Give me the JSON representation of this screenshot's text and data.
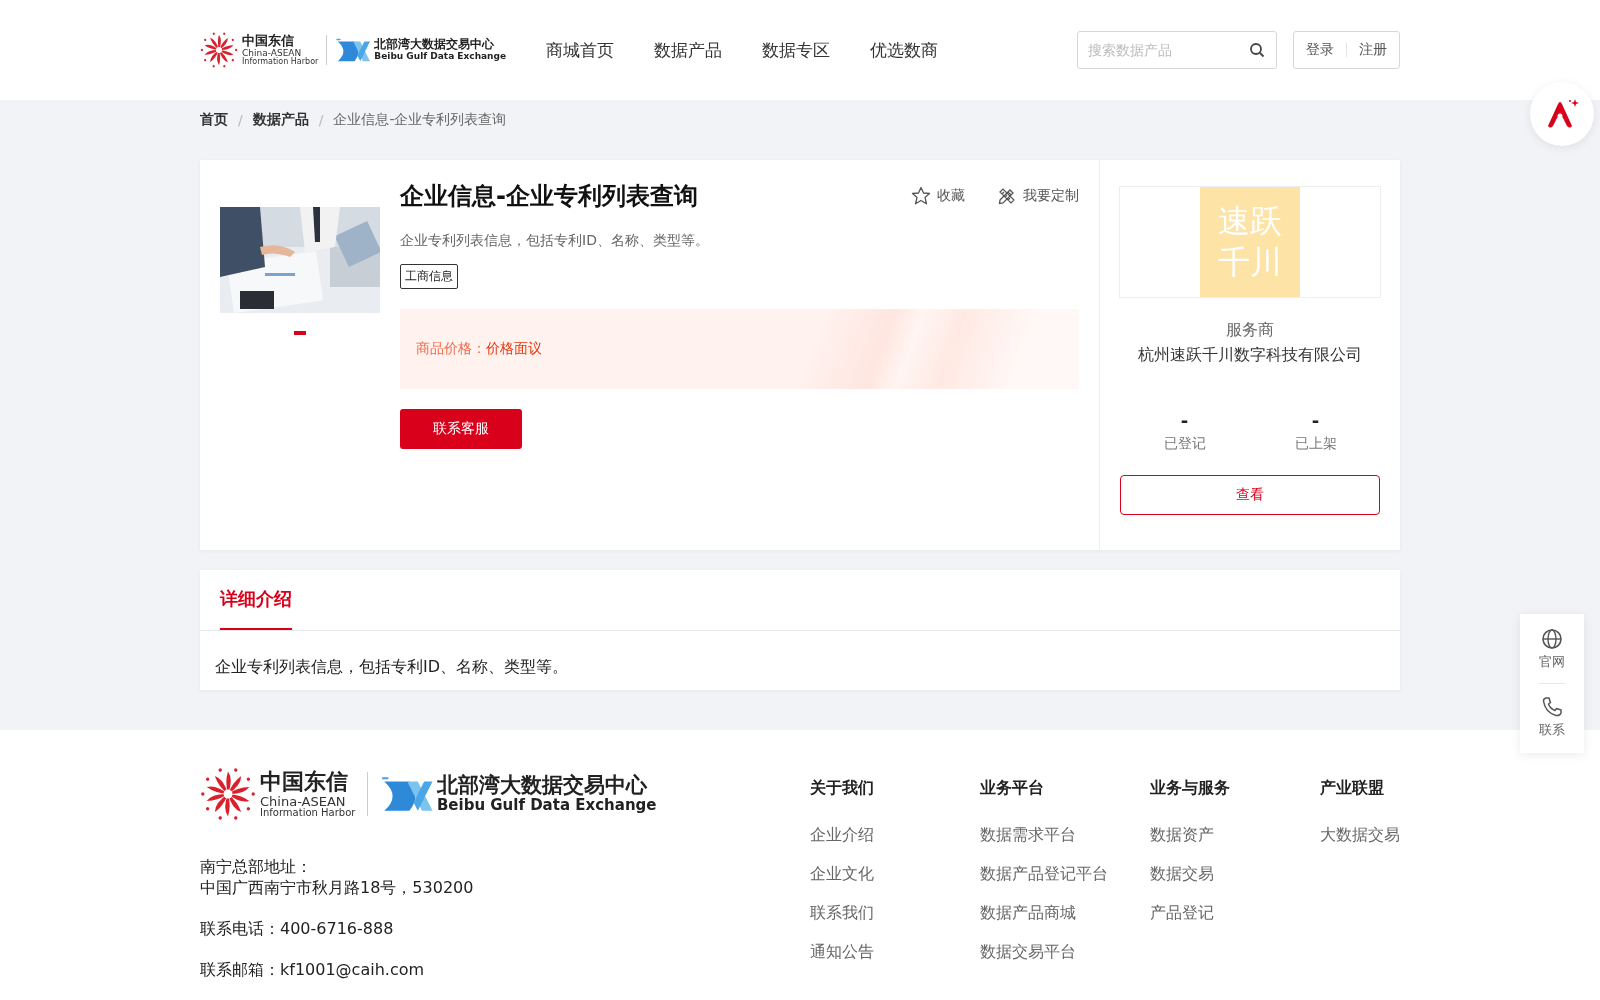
{
  "header": {
    "logo": {
      "cn_name": "中国东信",
      "en_line_1": "China-ASEAN",
      "en_line_2": "Information Harbor",
      "exchange_cn": "北部湾大数据交易中心",
      "exchange_en": "Beibu Gulf Data Exchange"
    },
    "nav": [
      {
        "label": "商城首页",
        "selected": false
      },
      {
        "label": "数据产品",
        "selected": false
      },
      {
        "label": "数据专区",
        "selected": false
      },
      {
        "label": "优选数商",
        "selected": false
      }
    ],
    "search": {
      "placeholder": "搜索数据产品"
    },
    "auth": [
      "登录",
      "注册"
    ]
  },
  "breadcrumb": {
    "items": [
      "首页",
      "数据产品",
      "企业信息-企业专利列表查询"
    ],
    "separators": [
      "/",
      "/"
    ]
  },
  "product": {
    "picture": {
      "kind": "picture"
    },
    "carousel_dots": [
      {
        "selected": true
      }
    ],
    "title": "企业信息-企业专利列表查询",
    "actions": [
      {
        "kind": "star",
        "label": "收藏"
      },
      {
        "kind": "pencil",
        "label": "我要定制"
      }
    ],
    "description": "企业专利列表信息，包括专利ID、名称、类型等。",
    "tags": [
      "工商信息"
    ],
    "price_label": "商品价格：",
    "price_value": "价格面议",
    "contact_button": "联系客服"
  },
  "provider": {
    "logo_lines": [
      "速跃",
      "千川"
    ],
    "role": "服务商",
    "name": "杭州速跃千川数字科技有限公司",
    "stats": [
      {
        "value": "-",
        "label": "已登记"
      },
      {
        "value": "-",
        "label": "已上架"
      }
    ],
    "view_button": "查看"
  },
  "detail": {
    "tabs": [
      {
        "label": "详细介绍",
        "selected": true
      }
    ],
    "content": "企业专利列表信息，包括专利ID、名称、类型等。"
  },
  "footer": {
    "logo": {
      "cn_name": "中国东信",
      "en_line_1": "China-ASEAN",
      "en_line_2": "Information Harbor",
      "exchange_cn": "北部湾大数据交易中心",
      "exchange_en": "Beibu Gulf Data Exchange"
    },
    "address_label": "南宁总部地址：",
    "address": "中国广西南宁市秋月路18号，530200",
    "phone": "联系电话：400-6716-888",
    "email": "联系邮箱：kf1001@caih.com",
    "columns": [
      {
        "title": "关于我们",
        "links": [
          "企业介绍",
          "企业文化",
          "联系我们",
          "通知公告"
        ]
      },
      {
        "title": "业务平台",
        "links": [
          "数据需求平台",
          "数据产品登记平台",
          "数据产品商城",
          "数据交易平台"
        ]
      },
      {
        "title": "业务与服务",
        "links": [
          "数据资产",
          "数据交易",
          "产品登记"
        ]
      },
      {
        "title": "产业联盟",
        "links": [
          "大数据交易"
        ]
      }
    ]
  },
  "float_tools": [
    {
      "kind": "globe",
      "label": "官网"
    },
    {
      "kind": "phone",
      "label": "联系"
    }
  ]
}
